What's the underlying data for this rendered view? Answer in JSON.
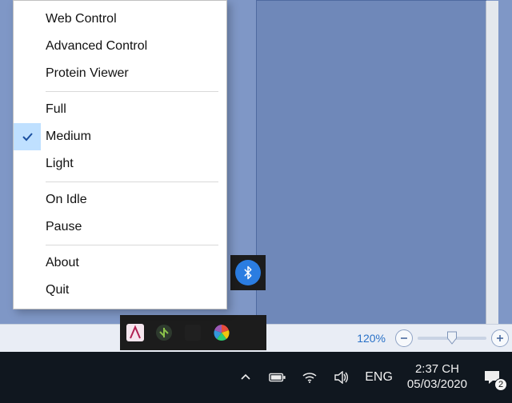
{
  "context_menu": {
    "groups": [
      [
        {
          "label": "Web Control",
          "checked": false
        },
        {
          "label": "Advanced Control",
          "checked": false
        },
        {
          "label": "Protein Viewer",
          "checked": false
        }
      ],
      [
        {
          "label": "Full",
          "checked": false
        },
        {
          "label": "Medium",
          "checked": true
        },
        {
          "label": "Light",
          "checked": false
        }
      ],
      [
        {
          "label": "On Idle",
          "checked": false
        },
        {
          "label": "Pause",
          "checked": false
        }
      ],
      [
        {
          "label": "About",
          "checked": false
        },
        {
          "label": "Quit",
          "checked": false
        }
      ]
    ]
  },
  "statusbar": {
    "zoom_label": "120%"
  },
  "taskbar": {
    "language": "ENG",
    "time": "2:37 CH",
    "date": "05/03/2020",
    "notification_count": "2"
  }
}
